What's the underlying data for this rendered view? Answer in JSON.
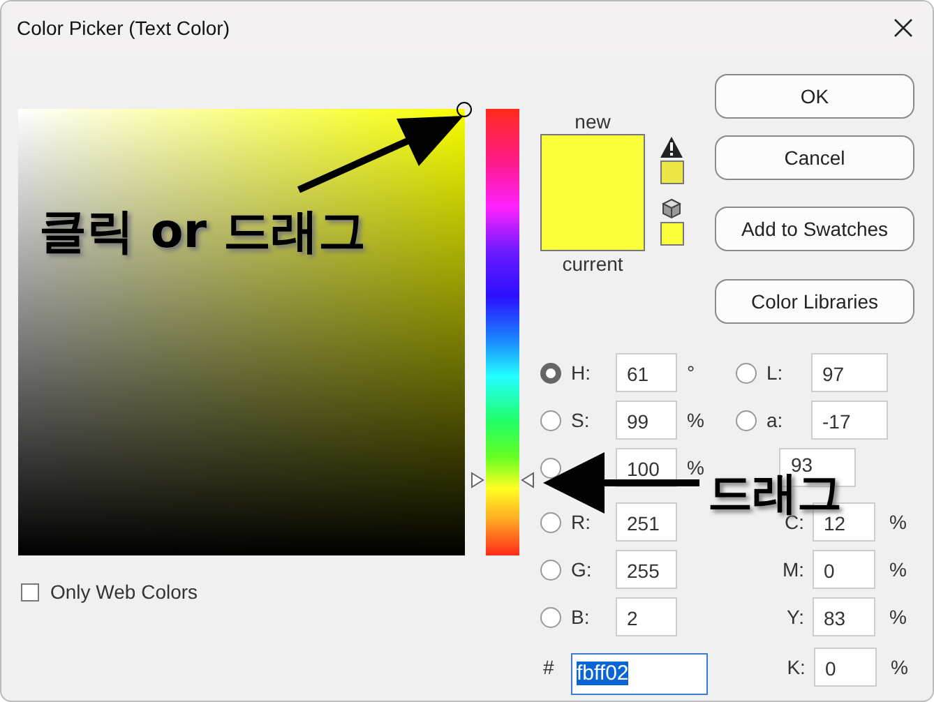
{
  "window": {
    "title": "Color Picker (Text Color)"
  },
  "hue_slider": {
    "level": 0.169
  },
  "preview": {
    "new_label": "new",
    "current_label": "current"
  },
  "buttons": [
    {
      "label": "OK"
    },
    {
      "label": "Cancel"
    },
    {
      "label": "Add to Swatches"
    },
    {
      "label": "Color Libraries"
    }
  ],
  "left_fields": [
    {
      "kind": "radio",
      "label": "H:",
      "value": "61",
      "unit": "°",
      "selected": true
    },
    {
      "kind": "radio",
      "label": "S:",
      "value": "99",
      "unit": "%",
      "selected": false
    },
    {
      "kind": "radio",
      "value": "100",
      "unit": "%",
      "selected": false
    },
    {
      "kind": "radio",
      "label": "R:",
      "value": "251",
      "selected": false
    },
    {
      "kind": "radio",
      "label": "G:",
      "value": "255",
      "selected": false
    },
    {
      "kind": "radio",
      "label": "B:",
      "value": "2",
      "selected": false
    }
  ],
  "right_fields": [
    {
      "kind": "radio",
      "label": "L:",
      "value": "97",
      "selected": false
    },
    {
      "kind": "radio",
      "label": "a:",
      "value": "-17",
      "selected": false
    },
    {
      "kind": "bare",
      "value": "93"
    },
    {
      "kind": "plain",
      "label": "C:",
      "value": "12",
      "unit": "%"
    },
    {
      "kind": "plain",
      "label": "M:",
      "value": "0",
      "unit": "%"
    },
    {
      "kind": "plain",
      "label": "Y:",
      "value": "83",
      "unit": "%"
    },
    {
      "kind": "plain",
      "label": "K:",
      "value": "0",
      "unit": "%"
    }
  ],
  "hex": {
    "label": "#",
    "value": "fbff02"
  },
  "only_web_colors": {
    "label": "Only Web Colors",
    "checked": false
  },
  "annotations": [
    {
      "text": "클릭 or 드래그"
    },
    {
      "text": "드래그"
    }
  ]
}
